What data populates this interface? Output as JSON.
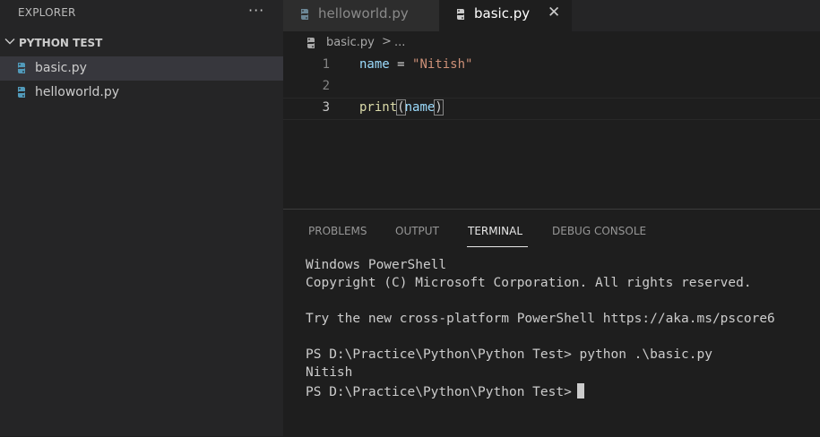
{
  "explorer": {
    "title": "EXPLORER",
    "more": "···",
    "folder": "PYTHON TEST",
    "files": [
      {
        "name": "basic.py",
        "active": true
      },
      {
        "name": "helloworld.py",
        "active": false
      }
    ]
  },
  "tabs": [
    {
      "label": "helloworld.py",
      "active": false
    },
    {
      "label": "basic.py",
      "active": true
    }
  ],
  "tab_close": "✕",
  "breadcrumb": {
    "file": "basic.py",
    "separator": ">",
    "more": "..."
  },
  "editor": {
    "lines": [
      {
        "number": "1",
        "var": "name",
        "op": " = ",
        "str": "\"Nitish\""
      },
      {
        "number": "2"
      },
      {
        "number": "3",
        "fn": "print",
        "open": "(",
        "arg": "name",
        "close": ")"
      }
    ]
  },
  "panel": {
    "tabs": [
      "PROBLEMS",
      "OUTPUT",
      "TERMINAL",
      "DEBUG CONSOLE"
    ],
    "active_tab": "TERMINAL",
    "terminal_lines": [
      "Windows PowerShell",
      "Copyright (C) Microsoft Corporation. All rights reserved.",
      "Try the new cross-platform PowerShell https://aka.ms/pscore6",
      "PS D:\\Practice\\Python\\Python Test> python .\\basic.py",
      "Nitish",
      "PS D:\\Practice\\Python\\Python Test>"
    ]
  },
  "colors": {
    "python_icon": "#519aba",
    "accent": "#007acc"
  },
  "icons": {
    "file": "python-file-icon",
    "more": "ellipsis-icon",
    "folder": "chevron-down-icon"
  }
}
